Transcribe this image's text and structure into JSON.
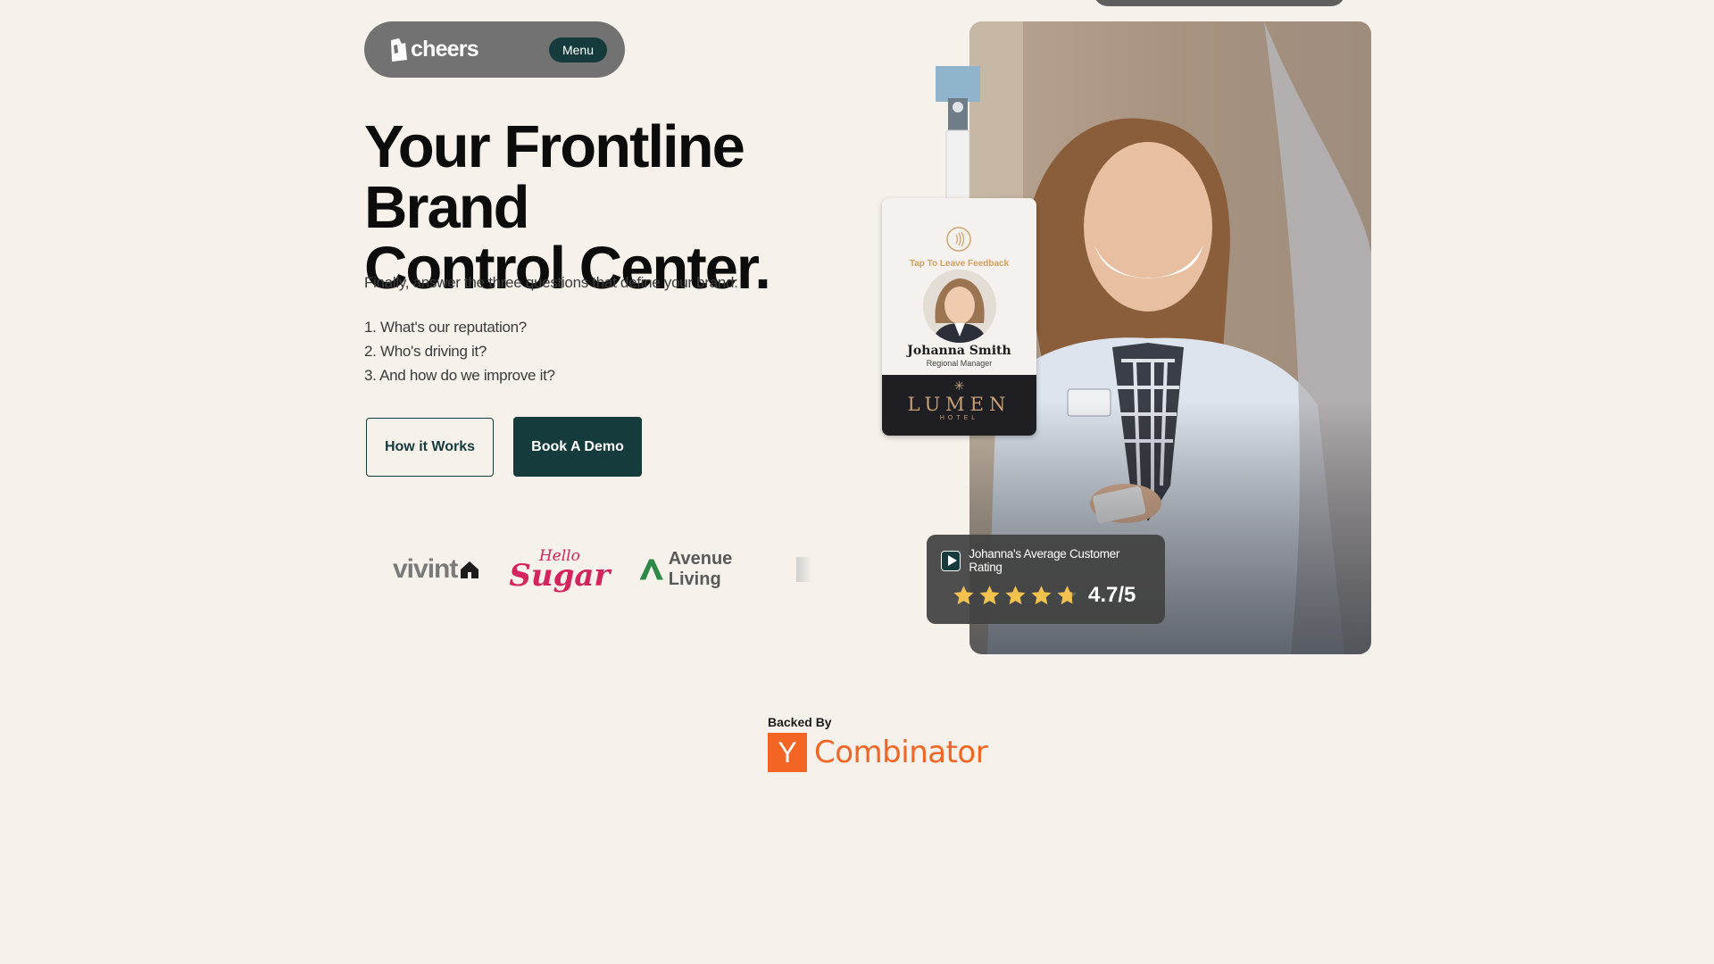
{
  "nav": {
    "logo_text": "cheers",
    "menu_label": "Menu"
  },
  "hero": {
    "headline_line1": "Your Frontline Brand",
    "headline_line2": "Control Center.",
    "intro": "Finally, answer the three questions that define your brand:",
    "questions": [
      "1. What's our reputation?",
      "2. Who's driving it?",
      "3. And how do we improve it?"
    ],
    "how_it_works_label": "How it Works",
    "book_demo_label": "Book A Demo"
  },
  "client_logos": {
    "vivint": "vivint",
    "hello_sugar_line1": "Hello",
    "hello_sugar_line2": "Sugar",
    "avenue_living": "Avenue Living"
  },
  "badge": {
    "tap_label": "Tap To Leave Feedback",
    "name": "Johanna Smith",
    "role": "Regional Manager",
    "brand": "LUMEN",
    "brand_sub": "HOTEL"
  },
  "rating_card": {
    "label": "Johanna's Average Customer Rating",
    "score": "4.7/5",
    "stars_filled": 4.7,
    "stars_total": 5
  },
  "backed_by": {
    "label": "Backed By",
    "yc_letter": "Y",
    "yc_name": "Combinator"
  },
  "colors": {
    "background": "#f6f1eb",
    "primary": "#163b3d",
    "star": "#f2c14e",
    "yc_orange": "#f26522"
  }
}
